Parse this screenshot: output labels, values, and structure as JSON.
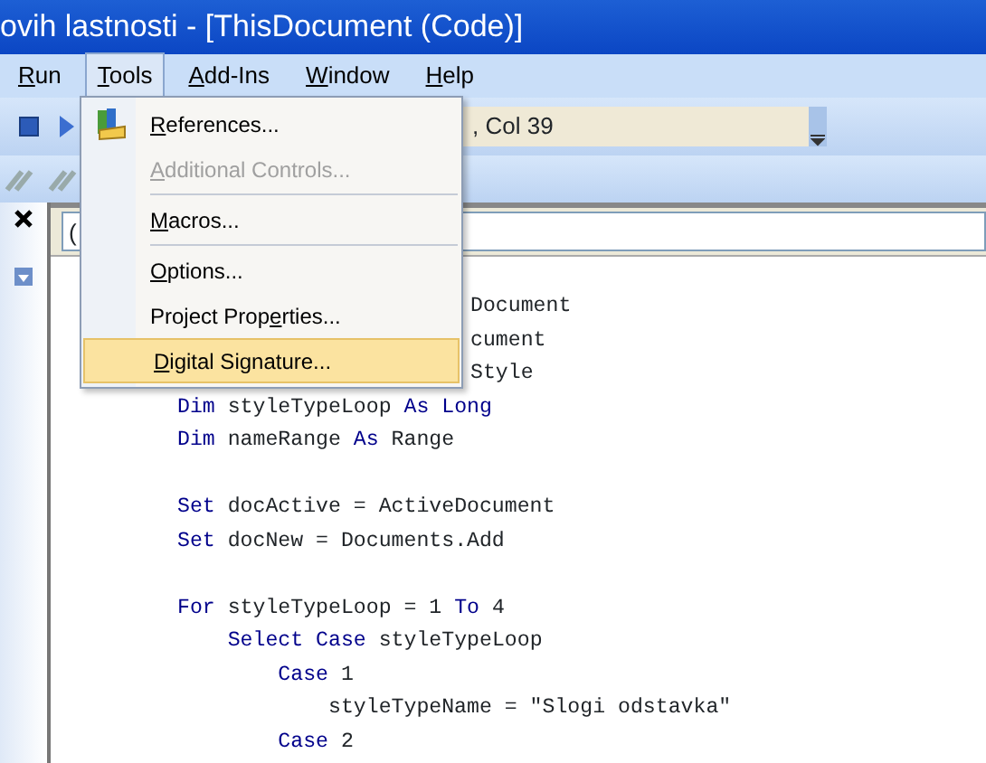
{
  "window": {
    "title": "ovih lastnosti - [ThisDocument (Code)]"
  },
  "menu_bar": [
    {
      "key": "R",
      "post": "un",
      "selected": false
    },
    {
      "key": "T",
      "post": "ools",
      "selected": true
    },
    {
      "key": "A",
      "post": "dd-Ins",
      "selected": false
    },
    {
      "key": "W",
      "post": "indow",
      "selected": false
    },
    {
      "key": "H",
      "post": "elp",
      "selected": false
    }
  ],
  "toolbar": {
    "position_box": ", Col 39"
  },
  "object_box": {
    "value": "("
  },
  "tools_menu": [
    {
      "kind": "icon_item",
      "key": "R",
      "post": "eferences...",
      "disabled": false,
      "selected": false
    },
    {
      "kind": "item",
      "key": "A",
      "post": "dditional Controls...",
      "disabled": true,
      "selected": false
    },
    {
      "kind": "separator"
    },
    {
      "kind": "item",
      "key": "M",
      "post": "acros...",
      "disabled": false,
      "selected": false
    },
    {
      "kind": "separator"
    },
    {
      "kind": "item",
      "key": "O",
      "post": "ptions...",
      "disabled": false,
      "selected": false
    },
    {
      "kind": "item",
      "pre": "Project Prop",
      "key": "e",
      "post": "rties...",
      "disabled": false,
      "selected": false
    },
    {
      "kind": "item",
      "key": "D",
      "post": "igital Signature...",
      "disabled": false,
      "selected": true
    }
  ],
  "code_lines": [
    {
      "kind": "covered",
      "tokens": [
        {
          "kind": "text",
          "text": "Document"
        }
      ]
    },
    {
      "kind": "covered",
      "tokens": [
        {
          "kind": "text",
          "text": "cument"
        }
      ]
    },
    {
      "kind": "covered",
      "tokens": [
        {
          "kind": "text",
          "text": "Style"
        }
      ]
    },
    {
      "kind": "code",
      "tokens": [
        {
          "kind": "keyword",
          "text": "Dim"
        },
        {
          "kind": "text",
          "text": " styleTypeLoop "
        },
        {
          "kind": "keyword",
          "text": "As Long"
        }
      ]
    },
    {
      "kind": "code",
      "tokens": [
        {
          "kind": "keyword",
          "text": "Dim"
        },
        {
          "kind": "text",
          "text": " nameRange "
        },
        {
          "kind": "keyword",
          "text": "As"
        },
        {
          "kind": "text",
          "text": " Range"
        }
      ]
    },
    {
      "kind": "blank"
    },
    {
      "kind": "code",
      "tokens": [
        {
          "kind": "keyword",
          "text": "Set"
        },
        {
          "kind": "text",
          "text": " docActive = ActiveDocument"
        }
      ]
    },
    {
      "kind": "code",
      "tokens": [
        {
          "kind": "keyword",
          "text": "Set"
        },
        {
          "kind": "text",
          "text": " docNew = Documents.Add"
        }
      ]
    },
    {
      "kind": "blank"
    },
    {
      "kind": "code",
      "tokens": [
        {
          "kind": "keyword",
          "text": "For"
        },
        {
          "kind": "text",
          "text": " styleTypeLoop = 1 "
        },
        {
          "kind": "keyword",
          "text": "To"
        },
        {
          "kind": "text",
          "text": " 4"
        }
      ]
    },
    {
      "kind": "code",
      "tokens": [
        {
          "kind": "keyword",
          "text": "    Select Case"
        },
        {
          "kind": "text",
          "text": " styleTypeLoop"
        }
      ]
    },
    {
      "kind": "code",
      "tokens": [
        {
          "kind": "keyword",
          "text": "        Case"
        },
        {
          "kind": "text",
          "text": " 1"
        }
      ]
    },
    {
      "kind": "code",
      "tokens": [
        {
          "kind": "text",
          "text": "            styleTypeName = \"Slogi odstavka\""
        }
      ]
    },
    {
      "kind": "code",
      "tokens": [
        {
          "kind": "keyword",
          "text": "        Case"
        },
        {
          "kind": "text",
          "text": " 2"
        }
      ]
    }
  ]
}
